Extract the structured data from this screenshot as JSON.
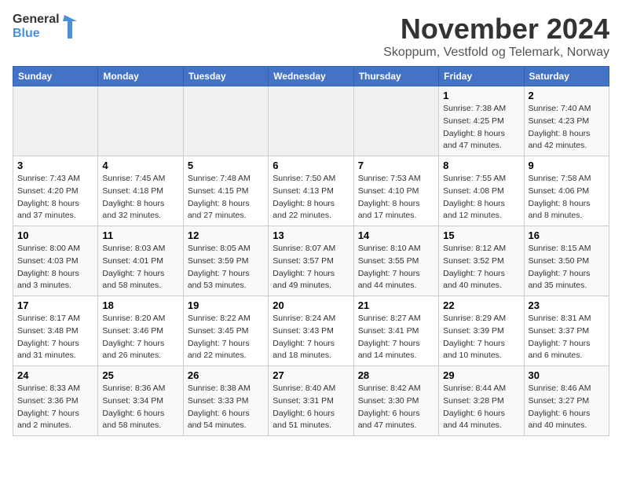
{
  "logo": {
    "line1": "General",
    "line2": "Blue"
  },
  "title": "November 2024",
  "subtitle": "Skoppum, Vestfold og Telemark, Norway",
  "headers": [
    "Sunday",
    "Monday",
    "Tuesday",
    "Wednesday",
    "Thursday",
    "Friday",
    "Saturday"
  ],
  "weeks": [
    {
      "days": [
        {
          "num": "",
          "info": ""
        },
        {
          "num": "",
          "info": ""
        },
        {
          "num": "",
          "info": ""
        },
        {
          "num": "",
          "info": ""
        },
        {
          "num": "",
          "info": ""
        },
        {
          "num": "1",
          "info": "Sunrise: 7:38 AM\nSunset: 4:25 PM\nDaylight: 8 hours and 47 minutes."
        },
        {
          "num": "2",
          "info": "Sunrise: 7:40 AM\nSunset: 4:23 PM\nDaylight: 8 hours and 42 minutes."
        }
      ]
    },
    {
      "days": [
        {
          "num": "3",
          "info": "Sunrise: 7:43 AM\nSunset: 4:20 PM\nDaylight: 8 hours and 37 minutes."
        },
        {
          "num": "4",
          "info": "Sunrise: 7:45 AM\nSunset: 4:18 PM\nDaylight: 8 hours and 32 minutes."
        },
        {
          "num": "5",
          "info": "Sunrise: 7:48 AM\nSunset: 4:15 PM\nDaylight: 8 hours and 27 minutes."
        },
        {
          "num": "6",
          "info": "Sunrise: 7:50 AM\nSunset: 4:13 PM\nDaylight: 8 hours and 22 minutes."
        },
        {
          "num": "7",
          "info": "Sunrise: 7:53 AM\nSunset: 4:10 PM\nDaylight: 8 hours and 17 minutes."
        },
        {
          "num": "8",
          "info": "Sunrise: 7:55 AM\nSunset: 4:08 PM\nDaylight: 8 hours and 12 minutes."
        },
        {
          "num": "9",
          "info": "Sunrise: 7:58 AM\nSunset: 4:06 PM\nDaylight: 8 hours and 8 minutes."
        }
      ]
    },
    {
      "days": [
        {
          "num": "10",
          "info": "Sunrise: 8:00 AM\nSunset: 4:03 PM\nDaylight: 8 hours and 3 minutes."
        },
        {
          "num": "11",
          "info": "Sunrise: 8:03 AM\nSunset: 4:01 PM\nDaylight: 7 hours and 58 minutes."
        },
        {
          "num": "12",
          "info": "Sunrise: 8:05 AM\nSunset: 3:59 PM\nDaylight: 7 hours and 53 minutes."
        },
        {
          "num": "13",
          "info": "Sunrise: 8:07 AM\nSunset: 3:57 PM\nDaylight: 7 hours and 49 minutes."
        },
        {
          "num": "14",
          "info": "Sunrise: 8:10 AM\nSunset: 3:55 PM\nDaylight: 7 hours and 44 minutes."
        },
        {
          "num": "15",
          "info": "Sunrise: 8:12 AM\nSunset: 3:52 PM\nDaylight: 7 hours and 40 minutes."
        },
        {
          "num": "16",
          "info": "Sunrise: 8:15 AM\nSunset: 3:50 PM\nDaylight: 7 hours and 35 minutes."
        }
      ]
    },
    {
      "days": [
        {
          "num": "17",
          "info": "Sunrise: 8:17 AM\nSunset: 3:48 PM\nDaylight: 7 hours and 31 minutes."
        },
        {
          "num": "18",
          "info": "Sunrise: 8:20 AM\nSunset: 3:46 PM\nDaylight: 7 hours and 26 minutes."
        },
        {
          "num": "19",
          "info": "Sunrise: 8:22 AM\nSunset: 3:45 PM\nDaylight: 7 hours and 22 minutes."
        },
        {
          "num": "20",
          "info": "Sunrise: 8:24 AM\nSunset: 3:43 PM\nDaylight: 7 hours and 18 minutes."
        },
        {
          "num": "21",
          "info": "Sunrise: 8:27 AM\nSunset: 3:41 PM\nDaylight: 7 hours and 14 minutes."
        },
        {
          "num": "22",
          "info": "Sunrise: 8:29 AM\nSunset: 3:39 PM\nDaylight: 7 hours and 10 minutes."
        },
        {
          "num": "23",
          "info": "Sunrise: 8:31 AM\nSunset: 3:37 PM\nDaylight: 7 hours and 6 minutes."
        }
      ]
    },
    {
      "days": [
        {
          "num": "24",
          "info": "Sunrise: 8:33 AM\nSunset: 3:36 PM\nDaylight: 7 hours and 2 minutes."
        },
        {
          "num": "25",
          "info": "Sunrise: 8:36 AM\nSunset: 3:34 PM\nDaylight: 6 hours and 58 minutes."
        },
        {
          "num": "26",
          "info": "Sunrise: 8:38 AM\nSunset: 3:33 PM\nDaylight: 6 hours and 54 minutes."
        },
        {
          "num": "27",
          "info": "Sunrise: 8:40 AM\nSunset: 3:31 PM\nDaylight: 6 hours and 51 minutes."
        },
        {
          "num": "28",
          "info": "Sunrise: 8:42 AM\nSunset: 3:30 PM\nDaylight: 6 hours and 47 minutes."
        },
        {
          "num": "29",
          "info": "Sunrise: 8:44 AM\nSunset: 3:28 PM\nDaylight: 6 hours and 44 minutes."
        },
        {
          "num": "30",
          "info": "Sunrise: 8:46 AM\nSunset: 3:27 PM\nDaylight: 6 hours and 40 minutes."
        }
      ]
    }
  ]
}
